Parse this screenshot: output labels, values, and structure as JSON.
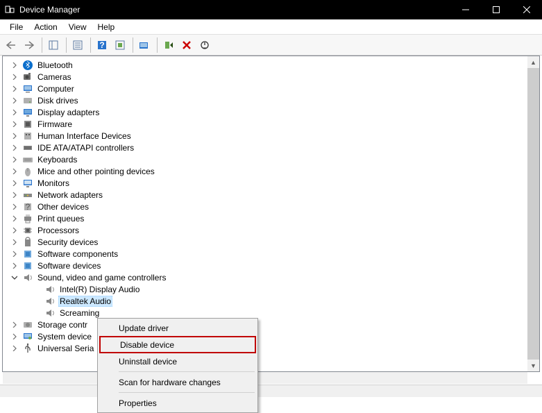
{
  "window": {
    "title": "Device Manager"
  },
  "menu": {
    "items": [
      "File",
      "Action",
      "View",
      "Help"
    ]
  },
  "toolbar": {
    "back": "back",
    "forward": "forward",
    "btns": [
      "show-hide-console-tree",
      "properties",
      "help",
      "update-driver",
      "uninstall-device",
      "scan-hardware",
      "add-legacy",
      "disable",
      "delete",
      "show-hidden"
    ]
  },
  "tree": [
    {
      "label": "Bluetooth",
      "icon": "bluetooth",
      "expanded": false
    },
    {
      "label": "Cameras",
      "icon": "camera",
      "expanded": false
    },
    {
      "label": "Computer",
      "icon": "computer",
      "expanded": false
    },
    {
      "label": "Disk drives",
      "icon": "drive",
      "expanded": false
    },
    {
      "label": "Display adapters",
      "icon": "display",
      "expanded": false
    },
    {
      "label": "Firmware",
      "icon": "firmware",
      "expanded": false
    },
    {
      "label": "Human Interface Devices",
      "icon": "hid",
      "expanded": false
    },
    {
      "label": "IDE ATA/ATAPI controllers",
      "icon": "ide",
      "expanded": false
    },
    {
      "label": "Keyboards",
      "icon": "keyboard",
      "expanded": false
    },
    {
      "label": "Mice and other pointing devices",
      "icon": "mouse",
      "expanded": false
    },
    {
      "label": "Monitors",
      "icon": "monitor",
      "expanded": false
    },
    {
      "label": "Network adapters",
      "icon": "network",
      "expanded": false
    },
    {
      "label": "Other devices",
      "icon": "other",
      "expanded": false
    },
    {
      "label": "Print queues",
      "icon": "printer",
      "expanded": false
    },
    {
      "label": "Processors",
      "icon": "cpu",
      "expanded": false
    },
    {
      "label": "Security devices",
      "icon": "security",
      "expanded": false
    },
    {
      "label": "Software components",
      "icon": "software",
      "expanded": false
    },
    {
      "label": "Software devices",
      "icon": "software",
      "expanded": false
    },
    {
      "label": "Sound, video and game controllers",
      "icon": "sound",
      "expanded": true,
      "children": [
        {
          "label": "Intel(R) Display Audio",
          "icon": "speaker"
        },
        {
          "label": "Realtek Audio",
          "icon": "speaker",
          "selected": true
        },
        {
          "label": "Screaming",
          "icon": "speaker"
        }
      ]
    },
    {
      "label": "Storage contr",
      "icon": "storage",
      "expanded": false
    },
    {
      "label": "System device",
      "icon": "system",
      "expanded": false
    },
    {
      "label": "Universal Seria",
      "icon": "usb",
      "expanded": false
    }
  ],
  "context_menu": {
    "items": [
      {
        "label": "Update driver",
        "highlight": false
      },
      {
        "label": "Disable device",
        "highlight": true
      },
      {
        "label": "Uninstall device",
        "highlight": false
      },
      {
        "sep": true
      },
      {
        "label": "Scan for hardware changes",
        "highlight": false
      },
      {
        "sep": true
      },
      {
        "label": "Properties",
        "highlight": false,
        "truncated": true
      }
    ]
  }
}
